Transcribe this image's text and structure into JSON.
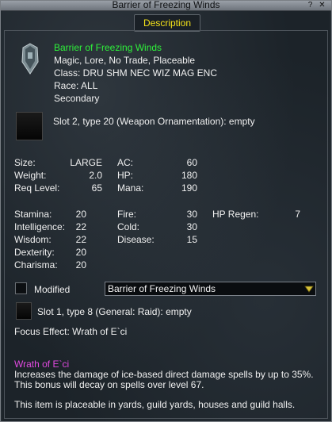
{
  "window": {
    "title": "Barrier of Freezing Winds",
    "help_label": "?",
    "close_label": "✕"
  },
  "tab": {
    "label": "Description"
  },
  "item": {
    "name": "Barrier of Freezing Winds",
    "flags": "Magic, Lore, No Trade, Placeable",
    "class_line": "Class: DRU SHM NEC WIZ MAG ENC",
    "race_line": "Race: ALL",
    "slot_line": "Secondary",
    "icon": "shield-icon"
  },
  "aug_slot_2": {
    "text": "Slot 2, type 20 (Weapon Ornamentation): empty"
  },
  "stats": {
    "size_label": "Size:",
    "size_value": "LARGE",
    "weight_label": "Weight:",
    "weight_value": "2.0",
    "reqlevel_label": "Req Level:",
    "reqlevel_value": "65",
    "ac_label": "AC:",
    "ac_value": "60",
    "hp_label": "HP:",
    "hp_value": "180",
    "mana_label": "Mana:",
    "mana_value": "190"
  },
  "attributes": {
    "stamina_label": "Stamina:",
    "stamina_value": "20",
    "intelligence_label": "Intelligence:",
    "intelligence_value": "22",
    "wisdom_label": "Wisdom:",
    "wisdom_value": "22",
    "dexterity_label": "Dexterity:",
    "dexterity_value": "20",
    "charisma_label": "Charisma:",
    "charisma_value": "20",
    "fire_label": "Fire:",
    "fire_value": "30",
    "cold_label": "Cold:",
    "cold_value": "30",
    "disease_label": "Disease:",
    "disease_value": "15",
    "hpregen_label": "HP Regen:",
    "hpregen_value": "7"
  },
  "modified": {
    "label": "Modified",
    "dropdown_value": "Barrier of Freezing Winds"
  },
  "aug_slot_1": {
    "text": "Slot 1, type 8 (General: Raid): empty"
  },
  "focus": {
    "line": "Focus Effect: Wrath of E`ci",
    "name": "Wrath of E`ci",
    "desc_1": "Increases the damage of ice-based direct damage spells by up to 35%.",
    "desc_2": "This bonus will decay on spells over level 67."
  },
  "placement_note": "This item is placeable in yards, guild yards, houses and guild halls."
}
